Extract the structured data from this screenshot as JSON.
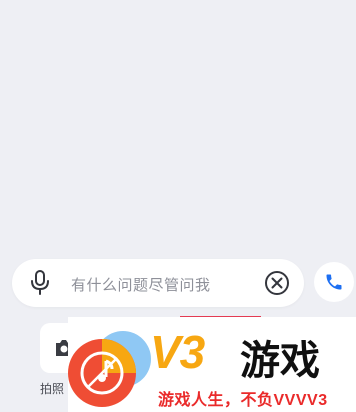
{
  "composer": {
    "placeholder": "有什么问题尽管问我"
  },
  "tools": {
    "photo_label": "拍照"
  },
  "watermark": {
    "brand": "V3",
    "brand_suffix": "游戏",
    "slogan": "游戏人生，不负VVVV3"
  },
  "colors": {
    "background": "#eeeff4",
    "accent": "#1d6ff2",
    "highlight": "#e43a52",
    "brand_orange": "#f7a712",
    "slogan_red": "#ea2a2a"
  },
  "icons": {
    "mic": "mic-icon",
    "clear": "clear-icon",
    "phone": "phone-icon",
    "camera": "camera-icon",
    "music": "music-note-icon"
  }
}
